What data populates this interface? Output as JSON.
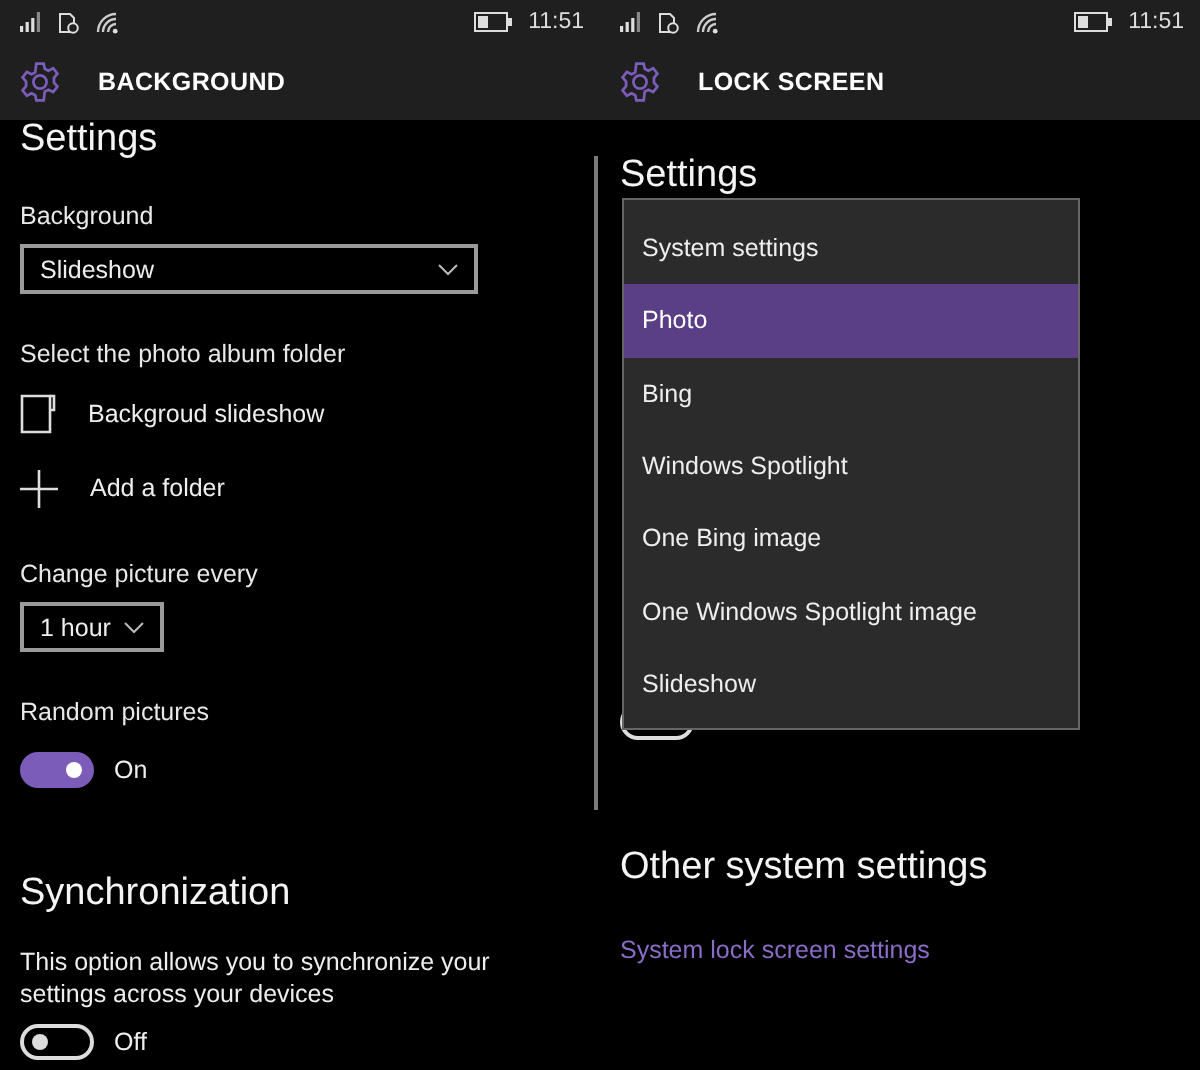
{
  "screens": [
    {
      "kind": "background",
      "status_bar": {
        "time": "11:51"
      },
      "header": {
        "title": "BACKGROUND"
      },
      "content": [
        {
          "kind": "heading",
          "text": "Settings"
        },
        {
          "kind": "label",
          "text": "Background"
        },
        {
          "kind": "dropdown",
          "value": "Slideshow"
        },
        {
          "kind": "label",
          "text": "Select the photo album folder"
        },
        {
          "kind": "folder",
          "text": "Backgroud slideshow"
        },
        {
          "kind": "add",
          "text": "Add a folder"
        },
        {
          "kind": "label",
          "text": "Change picture every"
        },
        {
          "kind": "picker",
          "value": "1 hour"
        },
        {
          "kind": "label",
          "text": "Random pictures"
        },
        {
          "kind": "toggle",
          "on": true,
          "text": "On"
        },
        {
          "kind": "heading",
          "text": "Synchronization"
        },
        {
          "kind": "paragraph",
          "text": "This option allows you to synchronize your settings across your devices"
        },
        {
          "kind": "toggle",
          "on": false,
          "text": "Off"
        }
      ]
    },
    {
      "kind": "lock",
      "status_bar": {
        "time": "11:51"
      },
      "header": {
        "title": "LOCK SCREEN"
      },
      "content": [
        {
          "kind": "heading",
          "text": "Settings"
        },
        {
          "kind": "toggle",
          "on": false
        },
        {
          "kind": "heading",
          "text": "Other system settings"
        },
        {
          "kind": "link",
          "text": "System lock screen settings"
        }
      ],
      "menu": {
        "items": [
          {
            "text": "System settings",
            "selected": false
          },
          {
            "text": "Photo",
            "selected": true
          },
          {
            "text": "Bing",
            "selected": false
          },
          {
            "text": "Windows Spotlight",
            "selected": false
          },
          {
            "text": "One Bing image",
            "selected": false
          },
          {
            "text": "One Windows Spotlight image",
            "selected": false
          },
          {
            "text": "Slideshow",
            "selected": false
          }
        ]
      }
    }
  ]
}
